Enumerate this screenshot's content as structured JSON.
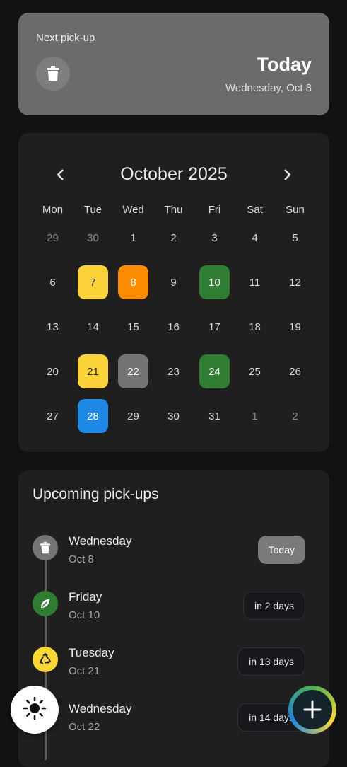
{
  "next_pickup": {
    "label": "Next pick-up",
    "icon": "trash-icon",
    "day": "Today",
    "date": "Wednesday, Oct 8"
  },
  "calendar": {
    "title": "October 2025",
    "weekdays": [
      "Mon",
      "Tue",
      "Wed",
      "Thu",
      "Fri",
      "Sat",
      "Sun"
    ],
    "weeks": [
      [
        {
          "d": "29",
          "muted": true
        },
        {
          "d": "30",
          "muted": true
        },
        {
          "d": "1"
        },
        {
          "d": "2"
        },
        {
          "d": "3"
        },
        {
          "d": "4"
        },
        {
          "d": "5"
        }
      ],
      [
        {
          "d": "6"
        },
        {
          "d": "7",
          "hl": "yellow"
        },
        {
          "d": "8",
          "hl": "orange"
        },
        {
          "d": "9"
        },
        {
          "d": "10",
          "hl": "green"
        },
        {
          "d": "11"
        },
        {
          "d": "12"
        }
      ],
      [
        {
          "d": "13"
        },
        {
          "d": "14"
        },
        {
          "d": "15"
        },
        {
          "d": "16"
        },
        {
          "d": "17"
        },
        {
          "d": "18"
        },
        {
          "d": "19"
        }
      ],
      [
        {
          "d": "20"
        },
        {
          "d": "21",
          "hl": "yellow"
        },
        {
          "d": "22",
          "hl": "gray"
        },
        {
          "d": "23"
        },
        {
          "d": "24",
          "hl": "green"
        },
        {
          "d": "25"
        },
        {
          "d": "26"
        }
      ],
      [
        {
          "d": "27"
        },
        {
          "d": "28",
          "hl": "blue"
        },
        {
          "d": "29"
        },
        {
          "d": "30"
        },
        {
          "d": "31"
        },
        {
          "d": "1",
          "muted": true
        },
        {
          "d": "2",
          "muted": true
        }
      ]
    ]
  },
  "upcoming": {
    "title": "Upcoming pick-ups",
    "items": [
      {
        "day": "Wednesday",
        "date": "Oct 8",
        "badge": "Today",
        "icon": "trash-icon",
        "color": "#757575",
        "today": true
      },
      {
        "day": "Friday",
        "date": "Oct 10",
        "badge": "in 2 days",
        "icon": "leaf-icon",
        "color": "#2e7d32"
      },
      {
        "day": "Tuesday",
        "date": "Oct 21",
        "badge": "in 13 days",
        "icon": "recycle-icon",
        "color": "#fdd835"
      },
      {
        "day": "Wednesday",
        "date": "Oct 22",
        "badge": "in 14 days",
        "icon": "trash-icon",
        "color": "#757575"
      }
    ]
  },
  "colors": {
    "yellow": "#fbd338",
    "orange": "#fb8c00",
    "green": "#2e7d32",
    "gray": "#737373",
    "blue": "#1e88e5"
  }
}
